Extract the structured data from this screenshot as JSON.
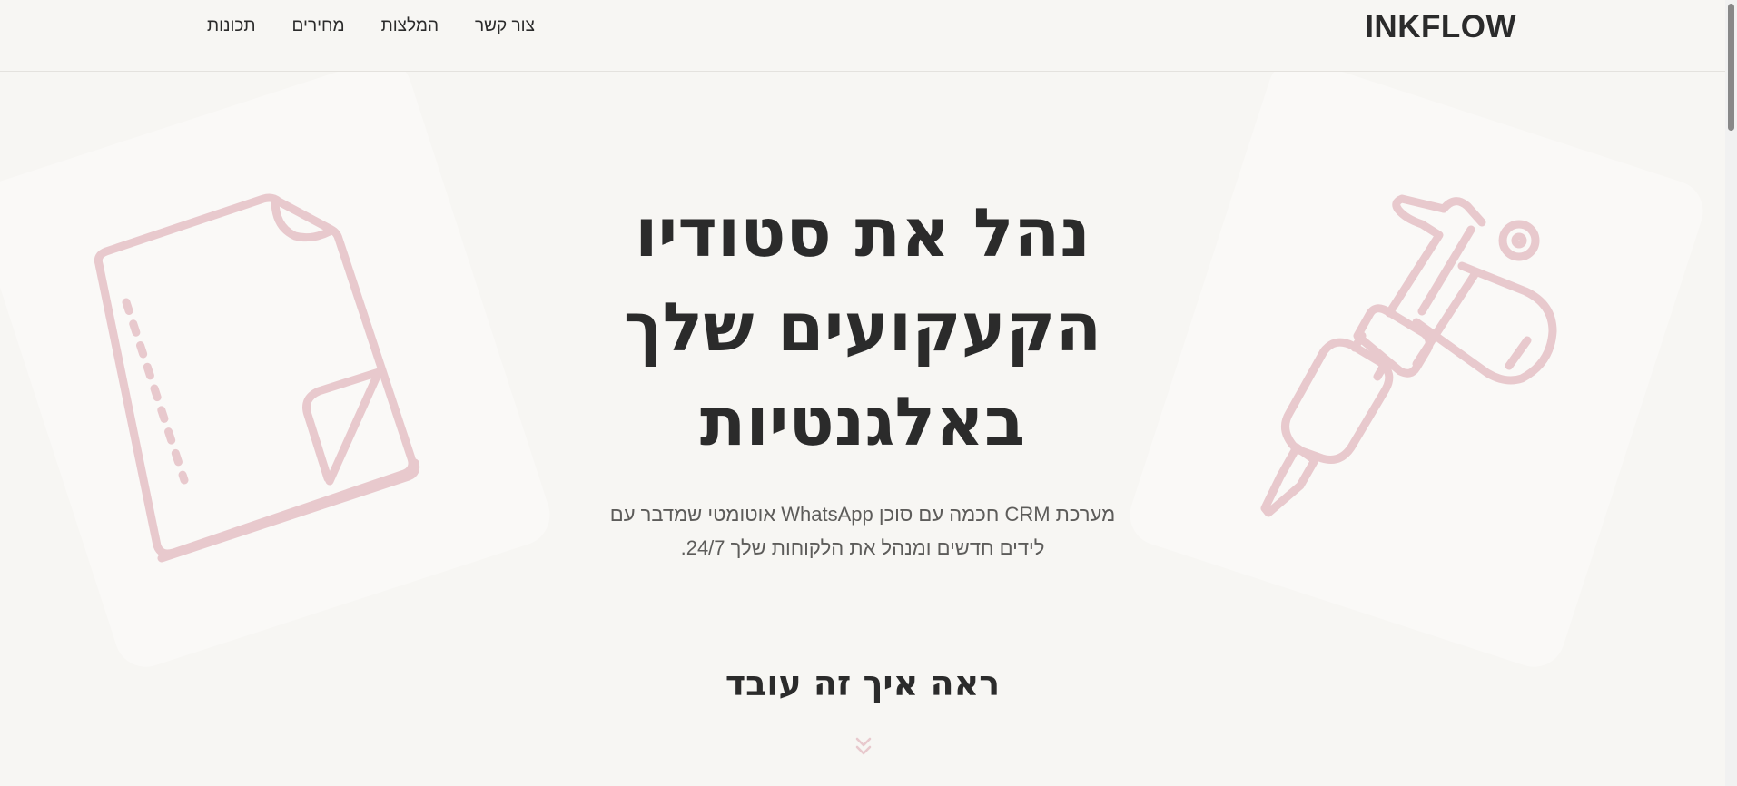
{
  "header": {
    "logo": "INKFLOW",
    "nav": [
      {
        "label": "תכונות",
        "key": "features"
      },
      {
        "label": "מחירים",
        "key": "pricing"
      },
      {
        "label": "המלצות",
        "key": "testimonials"
      },
      {
        "label": "צור קשר",
        "key": "contact"
      }
    ]
  },
  "hero": {
    "title_lines": [
      "נהל את סטודיו",
      "הקעקועים שלך",
      "באלגנטיות"
    ],
    "subtitle_lines": [
      "מערכת CRM חכמה עם סוכן WhatsApp אוטומטי שמדבר עם",
      "לידים חדשים ומנהל את הלקוחות שלך 24/7."
    ]
  },
  "how_it_works": {
    "title": "ראה איך זה עובד"
  },
  "icons": {
    "left": "notebook-icon",
    "right": "tattoo-machine-icon",
    "scroll": "double-chevron-down-icon"
  },
  "colors": {
    "background": "#f7f6f3",
    "card": "#faf9f7",
    "accent": "#e8c9cd",
    "text": "#2b2b2b",
    "muted": "#5d5c5a"
  }
}
